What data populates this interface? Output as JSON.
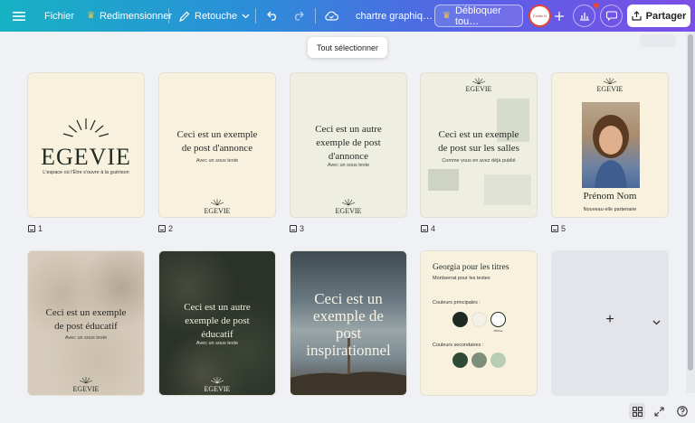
{
  "topbar": {
    "file_label": "Fichier",
    "resize_label": "Redimensionner",
    "retouch_label": "Retouche",
    "doc_title": "chartre graphiq…",
    "unlock_label": "Débloquer tou…",
    "avatar_text": "Emilie N",
    "share_label": "Partager"
  },
  "tooltip": "Tout sélectionner",
  "pages": [
    {
      "number": "1",
      "brand": "EGEVIE",
      "tagline": "L'espace où l'Être s'ouvre à la guérison"
    },
    {
      "number": "2",
      "title_line1": "Ceci est un exemple",
      "title_line2": "de post d'annonce",
      "subtitle": "Avec un sous texte",
      "brand": "EGEVIE"
    },
    {
      "number": "3",
      "title_line1": "Ceci est un autre",
      "title_line2": "exemple de post",
      "title_line3": "d'annonce",
      "subtitle": "Avec un sous texte",
      "brand": "EGEVIE"
    },
    {
      "number": "4",
      "brand": "EGEVIE",
      "title_line1": "Ceci est un exemple",
      "title_line2": "de post sur les salles",
      "subtitle": "Comme vous en avez déjà publié"
    },
    {
      "number": "5",
      "brand": "EGEVIE",
      "name": "Prénom Nom",
      "role": "Nouveau·elle partenaire"
    },
    {
      "title_line1": "Ceci est un exemple",
      "title_line2": "de post éducatif",
      "subtitle": "Avec un sous texte",
      "brand": "EGEVIE"
    },
    {
      "title_line1": "Ceci est un autre",
      "title_line2": "exemple de post",
      "title_line3": "éducatif",
      "subtitle": "Avec un sous texte",
      "brand": "EGEVIE"
    },
    {
      "title_line1": "Ceci est un",
      "title_line2": "exemple de",
      "title_line3": "post",
      "title_line4": "inspirationnel"
    },
    {
      "heading": "Georgia pour les titres",
      "subheading": "Montserrat pour les textes",
      "main_colors_label": "Couleurs principales :",
      "secondary_colors_label": "Couleurs secondaires :",
      "swatch_caption": "#f8f1de",
      "main_colors": [
        "#1f2a22",
        "#f3f0e6",
        "#ffffff"
      ],
      "secondary_colors": [
        "#2f4a36",
        "#7d8f78",
        "#b9cdb5"
      ]
    }
  ],
  "add_page_symbol": "+",
  "colors": {
    "cream": "#f8f1de",
    "sage": "#eeefe0",
    "accent": "#5b5ee6",
    "brand_dark": "#1f2a22"
  }
}
